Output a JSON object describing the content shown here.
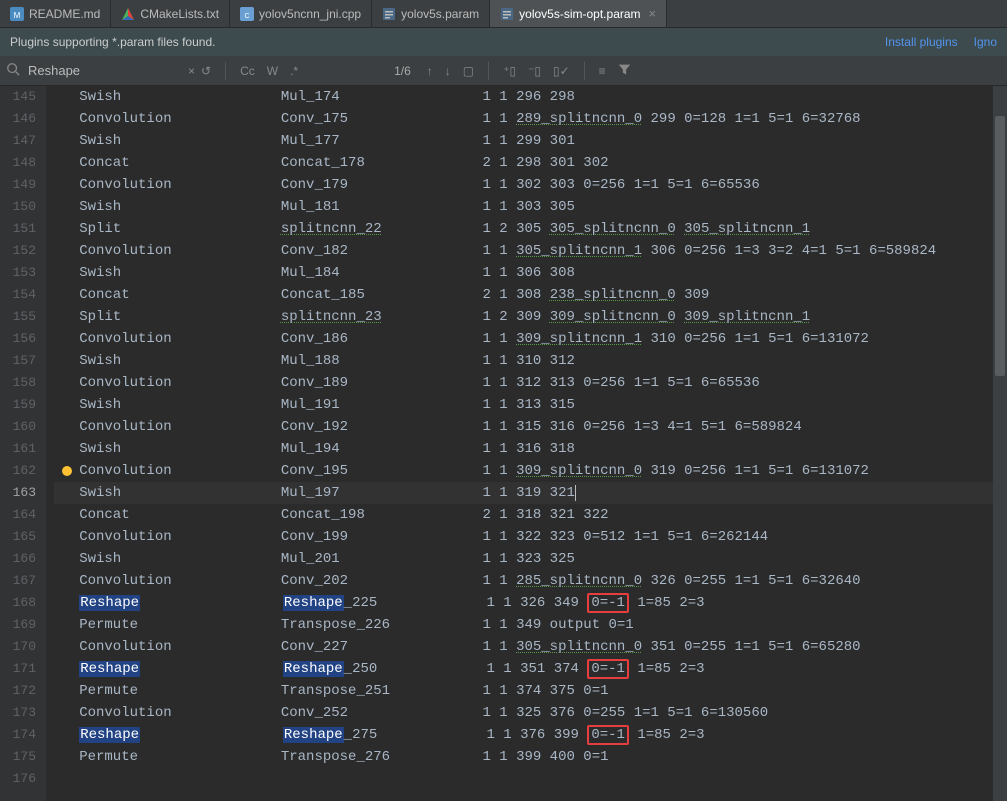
{
  "tabs": [
    {
      "label": "README.md",
      "icon": "md",
      "active": false
    },
    {
      "label": "CMakeLists.txt",
      "icon": "cmake",
      "active": false
    },
    {
      "label": "yolov5ncnn_jni.cpp",
      "icon": "cpp",
      "active": false
    },
    {
      "label": "yolov5s.param",
      "icon": "param",
      "active": false
    },
    {
      "label": "yolov5s-sim-opt.param",
      "icon": "param",
      "active": true
    }
  ],
  "notice": {
    "text": "Plugins supporting *.param files found.",
    "install": "Install plugins",
    "ignore": "Igno"
  },
  "find": {
    "value": "Reshape",
    "counter": "1/6",
    "opts": {
      "cc": "Cc",
      "w": "W",
      "regex": ".*"
    }
  },
  "lines": [
    {
      "n": 145,
      "op": "Swish",
      "name": "Mul_174",
      "params": "1 1 296 298"
    },
    {
      "n": 146,
      "op": "Convolution",
      "name": "Conv_175",
      "params": "1 1 289_splitncnn_0 299 0=128 1=1 5=1 6=32768",
      "ul": [
        "289_splitncnn_0"
      ]
    },
    {
      "n": 147,
      "op": "Swish",
      "name": "Mul_177",
      "params": "1 1 299 301"
    },
    {
      "n": 148,
      "op": "Concat",
      "name": "Concat_178",
      "params": "2 1 298 301 302"
    },
    {
      "n": 149,
      "op": "Convolution",
      "name": "Conv_179",
      "params": "1 1 302 303 0=256 1=1 5=1 6=65536"
    },
    {
      "n": 150,
      "op": "Swish",
      "name": "Mul_181",
      "params": "1 1 303 305"
    },
    {
      "n": 151,
      "op": "Split",
      "name": "splitncnn_22",
      "params": "1 2 305 305_splitncnn_0 305_splitncnn_1",
      "ul": [
        "splitncnn_22",
        "305_splitncnn_0",
        "305_splitncnn_1"
      ]
    },
    {
      "n": 152,
      "op": "Convolution",
      "name": "Conv_182",
      "params": "1 1 305_splitncnn_1 306 0=256 1=3 3=2 4=1 5=1 6=589824",
      "ul": [
        "305_splitncnn_1"
      ]
    },
    {
      "n": 153,
      "op": "Swish",
      "name": "Mul_184",
      "params": "1 1 306 308"
    },
    {
      "n": 154,
      "op": "Concat",
      "name": "Concat_185",
      "params": "2 1 308 238_splitncnn_0 309",
      "ul": [
        "238_splitncnn_0"
      ]
    },
    {
      "n": 155,
      "op": "Split",
      "name": "splitncnn_23",
      "params": "1 2 309 309_splitncnn_0 309_splitncnn_1",
      "ul": [
        "splitncnn_23",
        "309_splitncnn_0",
        "309_splitncnn_1"
      ]
    },
    {
      "n": 156,
      "op": "Convolution",
      "name": "Conv_186",
      "params": "1 1 309_splitncnn_1 310 0=256 1=1 5=1 6=131072",
      "ul": [
        "309_splitncnn_1"
      ]
    },
    {
      "n": 157,
      "op": "Swish",
      "name": "Mul_188",
      "params": "1 1 310 312"
    },
    {
      "n": 158,
      "op": "Convolution",
      "name": "Conv_189",
      "params": "1 1 312 313 0=256 1=1 5=1 6=65536"
    },
    {
      "n": 159,
      "op": "Swish",
      "name": "Mul_191",
      "params": "1 1 313 315"
    },
    {
      "n": 160,
      "op": "Convolution",
      "name": "Conv_192",
      "params": "1 1 315 316 0=256 1=3 4=1 5=1 6=589824"
    },
    {
      "n": 161,
      "op": "Swish",
      "name": "Mul_194",
      "params": "1 1 316 318"
    },
    {
      "n": 162,
      "op": "Convolution",
      "name": "Conv_195",
      "params": "1 1 309_splitncnn_0 319 0=256 1=1 5=1 6=131072",
      "ul": [
        "309_splitncnn_0"
      ],
      "dot": true
    },
    {
      "n": 163,
      "op": "Swish",
      "name": "Mul_197",
      "params": "1 1 319 321",
      "current": true,
      "caret": true
    },
    {
      "n": 164,
      "op": "Concat",
      "name": "Concat_198",
      "params": "2 1 318 321 322"
    },
    {
      "n": 165,
      "op": "Convolution",
      "name": "Conv_199",
      "params": "1 1 322 323 0=512 1=1 5=1 6=262144"
    },
    {
      "n": 166,
      "op": "Swish",
      "name": "Mul_201",
      "params": "1 1 323 325"
    },
    {
      "n": 167,
      "op": "Convolution",
      "name": "Conv_202",
      "params": "1 1 285_splitncnn_0 326 0=255 1=1 5=1 6=32640",
      "ul": [
        "285_splitncnn_0"
      ]
    },
    {
      "n": 168,
      "op": "Reshape",
      "name": "Reshape_225",
      "params": "1 1 326 349 0=-1 1=85 2=3",
      "hl": true,
      "box": "0=-1"
    },
    {
      "n": 169,
      "op": "Permute",
      "name": "Transpose_226",
      "params": "1 1 349 output 0=1"
    },
    {
      "n": 170,
      "op": "Convolution",
      "name": "Conv_227",
      "params": "1 1 305_splitncnn_0 351 0=255 1=1 5=1 6=65280",
      "ul": [
        "305_splitncnn_0"
      ]
    },
    {
      "n": 171,
      "op": "Reshape",
      "name": "Reshape_250",
      "params": "1 1 351 374 0=-1 1=85 2=3",
      "hl": true,
      "box": "0=-1"
    },
    {
      "n": 172,
      "op": "Permute",
      "name": "Transpose_251",
      "params": "1 1 374 375 0=1"
    },
    {
      "n": 173,
      "op": "Convolution",
      "name": "Conv_252",
      "params": "1 1 325 376 0=255 1=1 5=1 6=130560"
    },
    {
      "n": 174,
      "op": "Reshape",
      "name": "Reshape_275",
      "params": "1 1 376 399 0=-1 1=85 2=3",
      "hl": true,
      "box": "0=-1"
    },
    {
      "n": 175,
      "op": "Permute",
      "name": "Transpose_276",
      "params": "1 1 399 400 0=1"
    },
    {
      "n": 176,
      "op": "",
      "name": "",
      "params": ""
    }
  ]
}
